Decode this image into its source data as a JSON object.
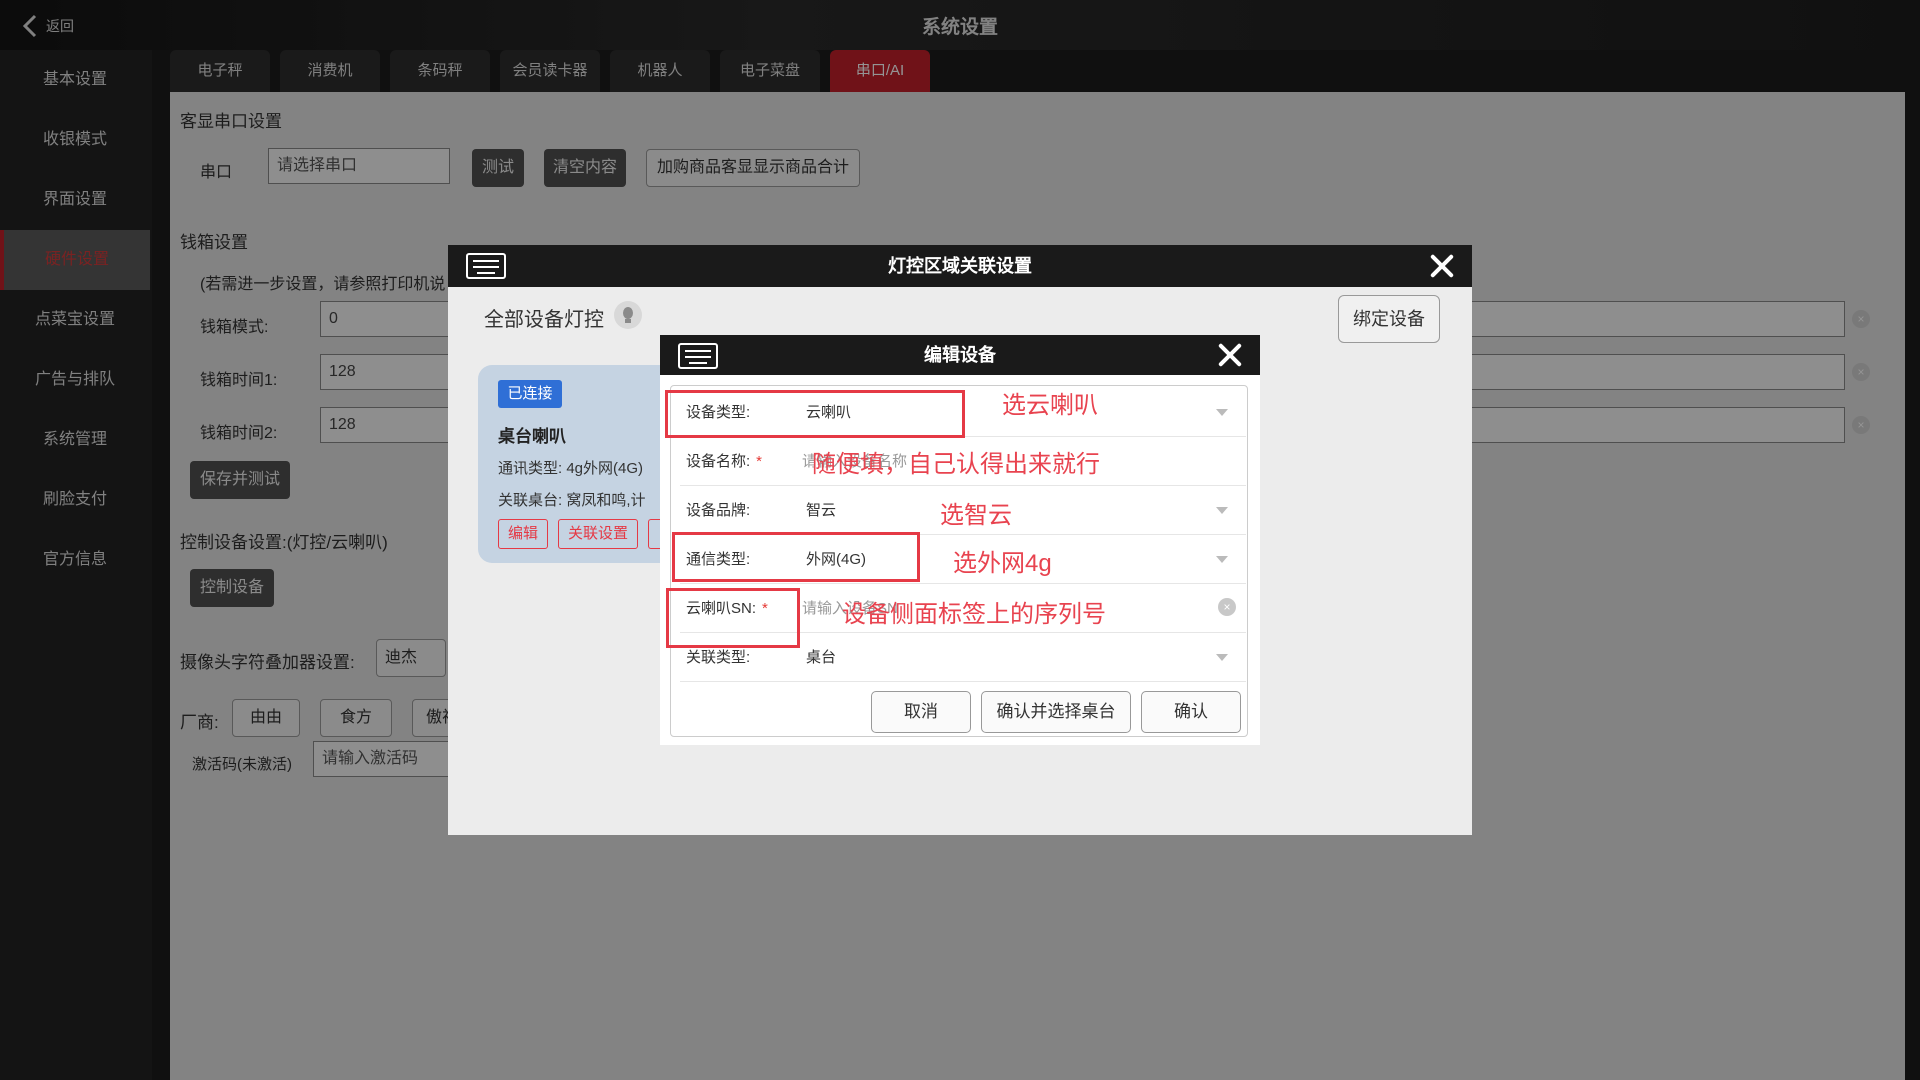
{
  "header": {
    "back_label": "返回",
    "title": "系统设置"
  },
  "sidebar": {
    "items": [
      {
        "label": "基本设置"
      },
      {
        "label": "收银模式"
      },
      {
        "label": "界面设置"
      },
      {
        "label": "硬件设置",
        "active": true
      },
      {
        "label": "点菜宝设置"
      },
      {
        "label": "广告与排队"
      },
      {
        "label": "系统管理"
      },
      {
        "label": "刷脸支付"
      },
      {
        "label": "官方信息"
      }
    ]
  },
  "tabs": [
    {
      "label": "电子秤"
    },
    {
      "label": "消费机"
    },
    {
      "label": "条码秤"
    },
    {
      "label": "会员读卡器"
    },
    {
      "label": "机器人"
    },
    {
      "label": "电子菜盘"
    },
    {
      "label": "串口/AI",
      "active": true
    }
  ],
  "main": {
    "customer_display": {
      "title": "客显串口设置",
      "port_label": "串口",
      "port_placeholder": "请选择串口",
      "test_button": "测试",
      "clear_button": "清空内容",
      "option_button": "加购商品客显显示商品合计"
    },
    "cash_drawer": {
      "title": "钱箱设置",
      "note": "(若需进一步设置，请参照打印机说",
      "mode_label": "钱箱模式:",
      "mode_value": "0",
      "time1_label": "钱箱时间1:",
      "time1_value": "128",
      "time2_label": "钱箱时间2:",
      "time2_value": "128",
      "save_button": "保存并测试"
    },
    "control": {
      "title": "控制设备设置:(灯控/云喇叭)",
      "button": "控制设备"
    },
    "camera": {
      "label": "摄像头字符叠加器设置:",
      "value": "迪杰"
    },
    "vendor": {
      "label": "厂商:",
      "options": [
        "由由",
        "食方",
        "傲视"
      ]
    },
    "activation": {
      "label": "激活码(未激活)",
      "placeholder": "请输入激活码"
    }
  },
  "light_dialog": {
    "title": "灯控区域关联设置",
    "all_devices_label": "全部设备灯控",
    "bind_button": "绑定设备",
    "card": {
      "status": "已连接",
      "name": "桌台喇叭",
      "comm_line": "通讯类型:  4g外网(4G)",
      "table_line": "关联桌台: 窝凤和鸣,计",
      "edit_button": "编辑",
      "link_button": "关联设置"
    }
  },
  "edit_dialog": {
    "title": "编辑设备",
    "fields": [
      {
        "label": "设备类型:",
        "value": "云喇叭",
        "required": false,
        "dropdown": true
      },
      {
        "label": "设备名称:",
        "value": "请输入设备名称",
        "placeholder": true,
        "required": true,
        "dropdown": false
      },
      {
        "label": "设备品牌:",
        "value": "智云",
        "required": false,
        "dropdown": true
      },
      {
        "label": "通信类型:",
        "value": "外网(4G)",
        "required": false,
        "dropdown": true
      },
      {
        "label": "云喇叭SN:",
        "value": "请输入设备SN",
        "placeholder": true,
        "required": true,
        "dropdown": false
      },
      {
        "label": "关联类型:",
        "value": "桌台",
        "required": false,
        "dropdown": true
      }
    ],
    "required_mark": "*",
    "cancel_button": "取消",
    "confirm_select_button": "确认并选择桌台",
    "confirm_button": "确认"
  },
  "annotations": [
    "选云喇叭",
    "随便填，自己认得出来就行",
    "选智云",
    "选外网4g",
    "设备侧面标签上的序列号"
  ],
  "colors": {
    "accent": "#c21f2a",
    "annotation": "#e53945",
    "status_badge": "#2f6fd6"
  }
}
